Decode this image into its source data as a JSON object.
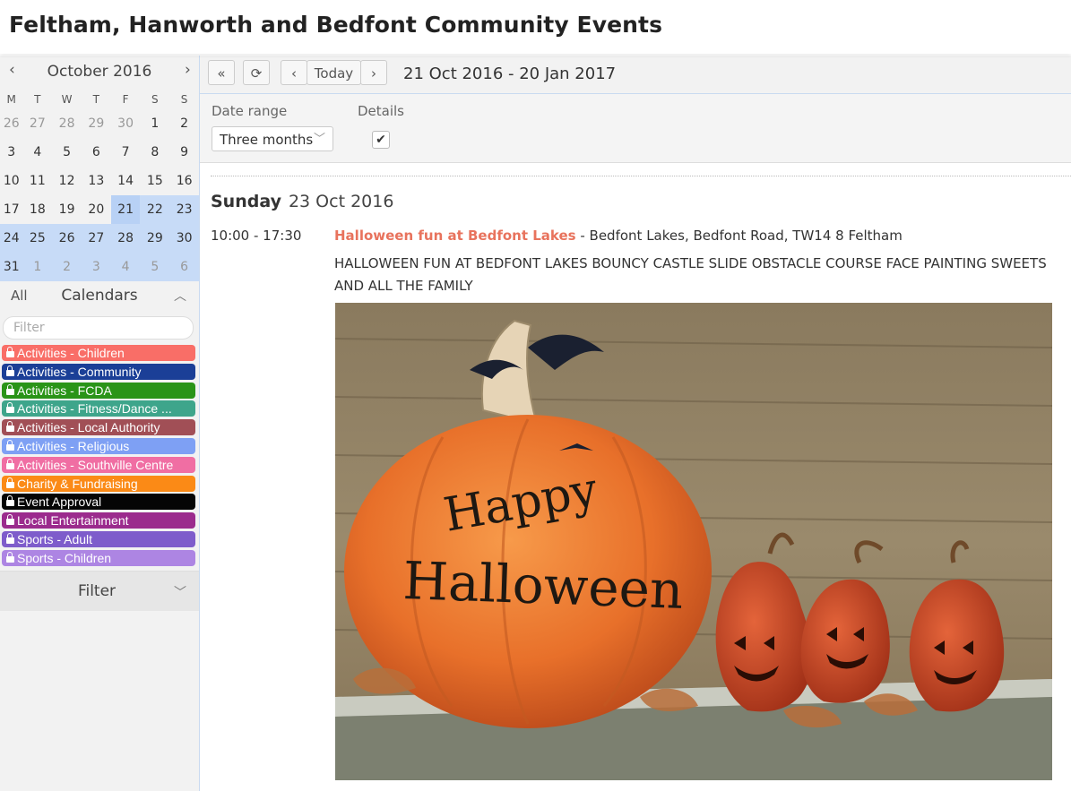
{
  "app": {
    "title": "Feltham, Hanworth and Bedfont Community Events"
  },
  "mini_calendar": {
    "month_label": "October 2016",
    "prev": "‹",
    "next": "›",
    "weekdays": [
      "M",
      "T",
      "W",
      "T",
      "F",
      "S",
      "S"
    ],
    "weeks": [
      [
        "26",
        "27",
        "28",
        "29",
        "30",
        "1",
        "2"
      ],
      [
        "3",
        "4",
        "5",
        "6",
        "7",
        "8",
        "9"
      ],
      [
        "10",
        "11",
        "12",
        "13",
        "14",
        "15",
        "16"
      ],
      [
        "17",
        "18",
        "19",
        "20",
        "21",
        "22",
        "23"
      ],
      [
        "24",
        "25",
        "26",
        "27",
        "28",
        "29",
        "30"
      ],
      [
        "31",
        "1",
        "2",
        "3",
        "4",
        "5",
        "6"
      ]
    ]
  },
  "calendars_section": {
    "all_label": "All",
    "title": "Calendars",
    "filter_placeholder": "Filter"
  },
  "calendars": [
    {
      "label": "Activities - Children",
      "color": "#f96e67"
    },
    {
      "label": "Activities - Community",
      "color": "#1b3f97"
    },
    {
      "label": "Activities - FCDA",
      "color": "#2a9418"
    },
    {
      "label": "Activities - Fitness/Dance ...",
      "color": "#3ea58b"
    },
    {
      "label": "Activities - Local Authority",
      "color": "#a14f56"
    },
    {
      "label": "Activities - Religious",
      "color": "#7ea0f4"
    },
    {
      "label": "Activities - Southville Centre",
      "color": "#f06ea3"
    },
    {
      "label": "Charity & Fundraising",
      "color": "#fb8a16"
    },
    {
      "label": "Event Approval",
      "color": "#050505"
    },
    {
      "label": "Local Entertainment",
      "color": "#9b2b8d"
    },
    {
      "label": "Sports - Adult",
      "color": "#7e5ccb"
    },
    {
      "label": "Sports - Children",
      "color": "#ad85e3"
    }
  ],
  "filter_section": {
    "title": "Filter"
  },
  "toolbar": {
    "first_icon": "«",
    "refresh_icon": "⟳",
    "prev_icon": "‹",
    "today_label": "Today",
    "next_icon": "›",
    "range_label": "21 Oct 2016 - 20 Jan 2017"
  },
  "controls": {
    "date_range_label": "Date range",
    "date_range_value": "Three months",
    "details_label": "Details",
    "details_checked": "✔"
  },
  "agenda": {
    "day_name": "Sunday",
    "day_date": "23 Oct 2016",
    "event": {
      "time": "10:00 - 17:30",
      "title": "Halloween fun at Bedfont Lakes",
      "location": " - Bedfont Lakes, Bedfont Road, TW14 8 Feltham",
      "description": "HALLOWEEN FUN AT BEDFONT LAKES BOUNCY CASTLE SLIDE OBSTACLE COURSE FACE PAINTING SWEETS AND ALL THE FAMILY",
      "image_text_1": "Happy",
      "image_text_2": "Halloween"
    }
  }
}
